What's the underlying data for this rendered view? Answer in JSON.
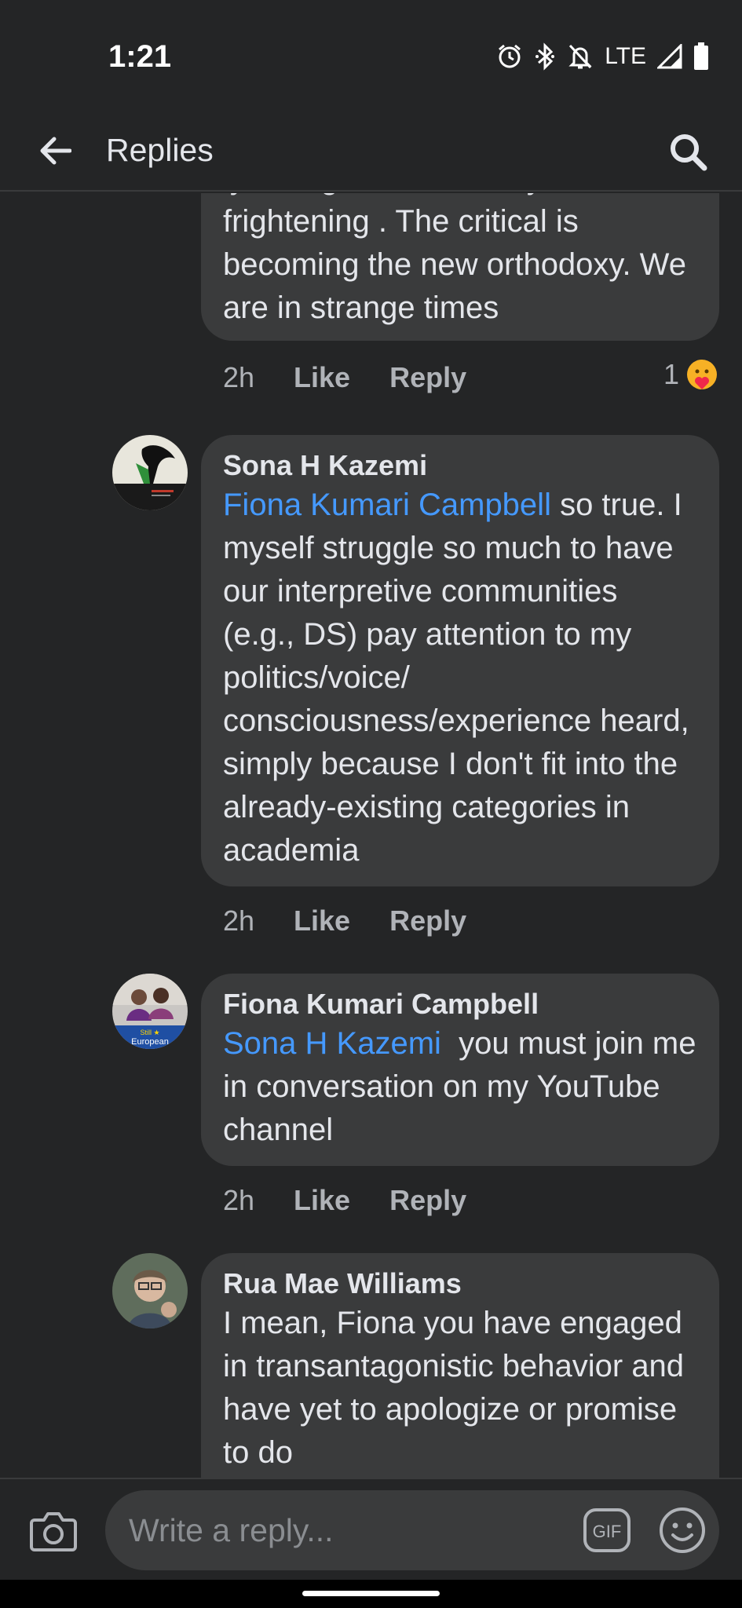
{
  "status_bar": {
    "time": "1:21",
    "network": "LTE"
  },
  "app_bar": {
    "title": "Replies",
    "back_icon": "back-arrow-icon",
    "search_icon": "search-icon"
  },
  "comments": [
    {
      "partial_line": "lynching which is really",
      "text": "frightening . The critical is becoming the new orthodoxy. We are in strange times",
      "time": "2h",
      "like_label": "Like",
      "reply_label": "Reply",
      "reaction_count": "1",
      "reaction_icon": "care-reaction-icon"
    },
    {
      "author": "Sona H Kazemi",
      "mention": "Fiona Kumari Campbell",
      "text": " so true. I myself struggle so much to have our interpretive communities (e.g., DS) pay attention to my politics/voice/ consciousness/experience heard, simply because I don't fit into the already-existing categories in academia",
      "time": "2h",
      "like_label": "Like",
      "reply_label": "Reply"
    },
    {
      "author": "Fiona Kumari Campbell",
      "mention": "Sona H Kazemi",
      "text": "  you must join me in conversation on my YouTube channel",
      "time": "2h",
      "like_label": "Like",
      "reply_label": "Reply",
      "avatar_badge": "Still European"
    },
    {
      "author": "Rua Mae Williams",
      "text": "I mean, Fiona you have engaged in transantagonistic behavior and have yet to apologize or promise to do"
    }
  ],
  "composer": {
    "placeholder": "Write a reply...",
    "gif_label": "GIF"
  },
  "colors": {
    "background": "#242526",
    "bubble": "#3a3b3c",
    "mention": "#4599ff",
    "muted": "#b0b3b8"
  }
}
